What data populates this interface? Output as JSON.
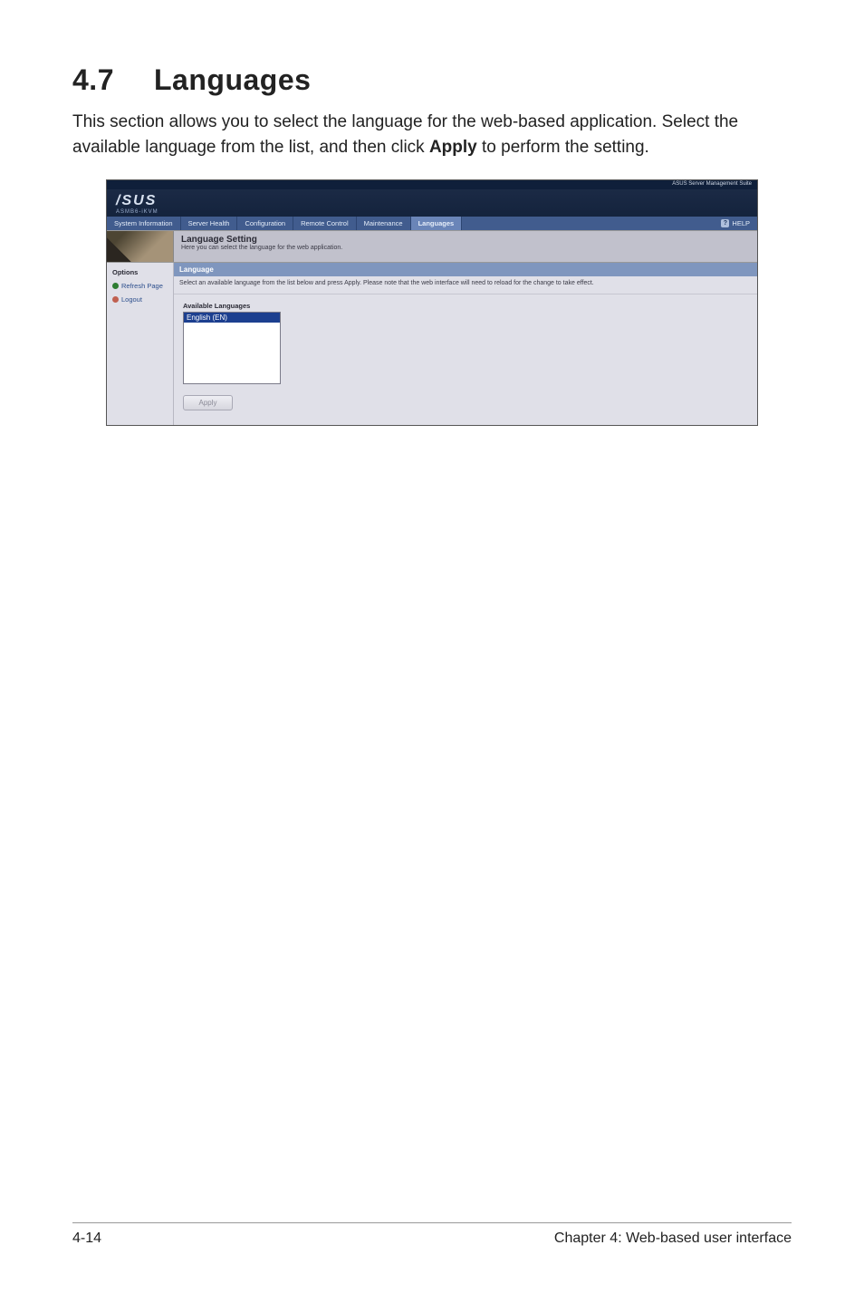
{
  "heading": {
    "number": "4.7",
    "title": "Languages"
  },
  "intro": {
    "line1": "This section allows you to select the language for the web-based application.",
    "line2_pre": "Select the available language from the list, and then click ",
    "line2_strong": "Apply",
    "line2_post": " to perform the setting."
  },
  "screenshot": {
    "topstrip": "ASUS Server Management Suite",
    "logo_main": "/SUS",
    "logo_sub": "ASMB6-iKVM",
    "tabs": [
      "System Information",
      "Server Health",
      "Configuration",
      "Remote Control",
      "Maintenance",
      "Languages"
    ],
    "active_tab_index": 5,
    "help_label": "HELP",
    "titlebar": {
      "title": "Language Setting",
      "sub": "Here you can select the language for the web application."
    },
    "sidebar": {
      "title": "Options",
      "items": [
        {
          "label": "Refresh Page",
          "icon": "refresh"
        },
        {
          "label": "Logout",
          "icon": "logout"
        }
      ]
    },
    "main": {
      "panel_title": "Language",
      "panel_sub": "Select an available language from the list below and press Apply. Please note that the web interface will need to reload for the change to take effect.",
      "available_label": "Available Languages",
      "list_options": [
        "English (EN)"
      ],
      "list_selected": 0,
      "apply_label": "Apply"
    }
  },
  "footer": {
    "left": "4-14",
    "right": "Chapter 4: Web-based user interface"
  }
}
